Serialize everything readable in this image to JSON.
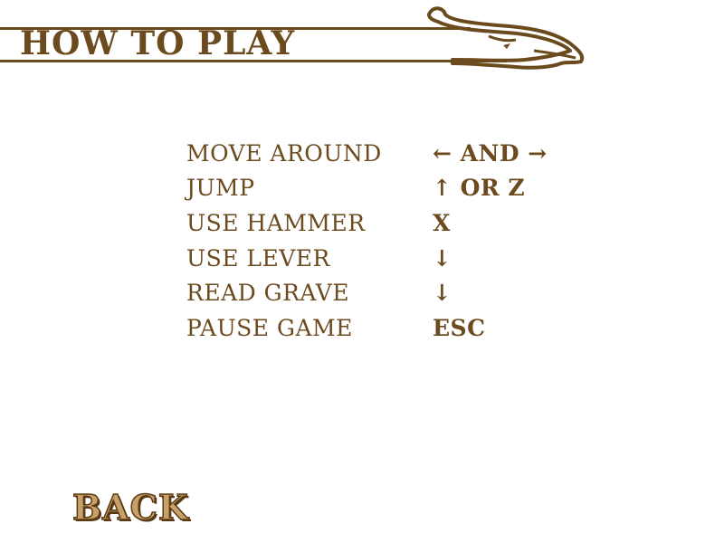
{
  "header": {
    "title": "HOW TO PLAY"
  },
  "controls": [
    {
      "action": "MOVE AROUND",
      "key": "← AND →"
    },
    {
      "action": "JUMP",
      "key": "↑ OR Z"
    },
    {
      "action": "USE HAMMER",
      "key": "X"
    },
    {
      "action": "USE LEVER",
      "key": "↓"
    },
    {
      "action": "READ GRAVE",
      "key": "↓"
    },
    {
      "action": "PAUSE GAME",
      "key": "ESC"
    }
  ],
  "back_button": {
    "label": "BACK"
  },
  "colors": {
    "text": "#6b4a1e",
    "back_fill": "#c8a06a",
    "back_outline": "#5a3a14",
    "background": "#ffffff"
  },
  "icons": {
    "header_ornament": "dragon-head-icon"
  }
}
